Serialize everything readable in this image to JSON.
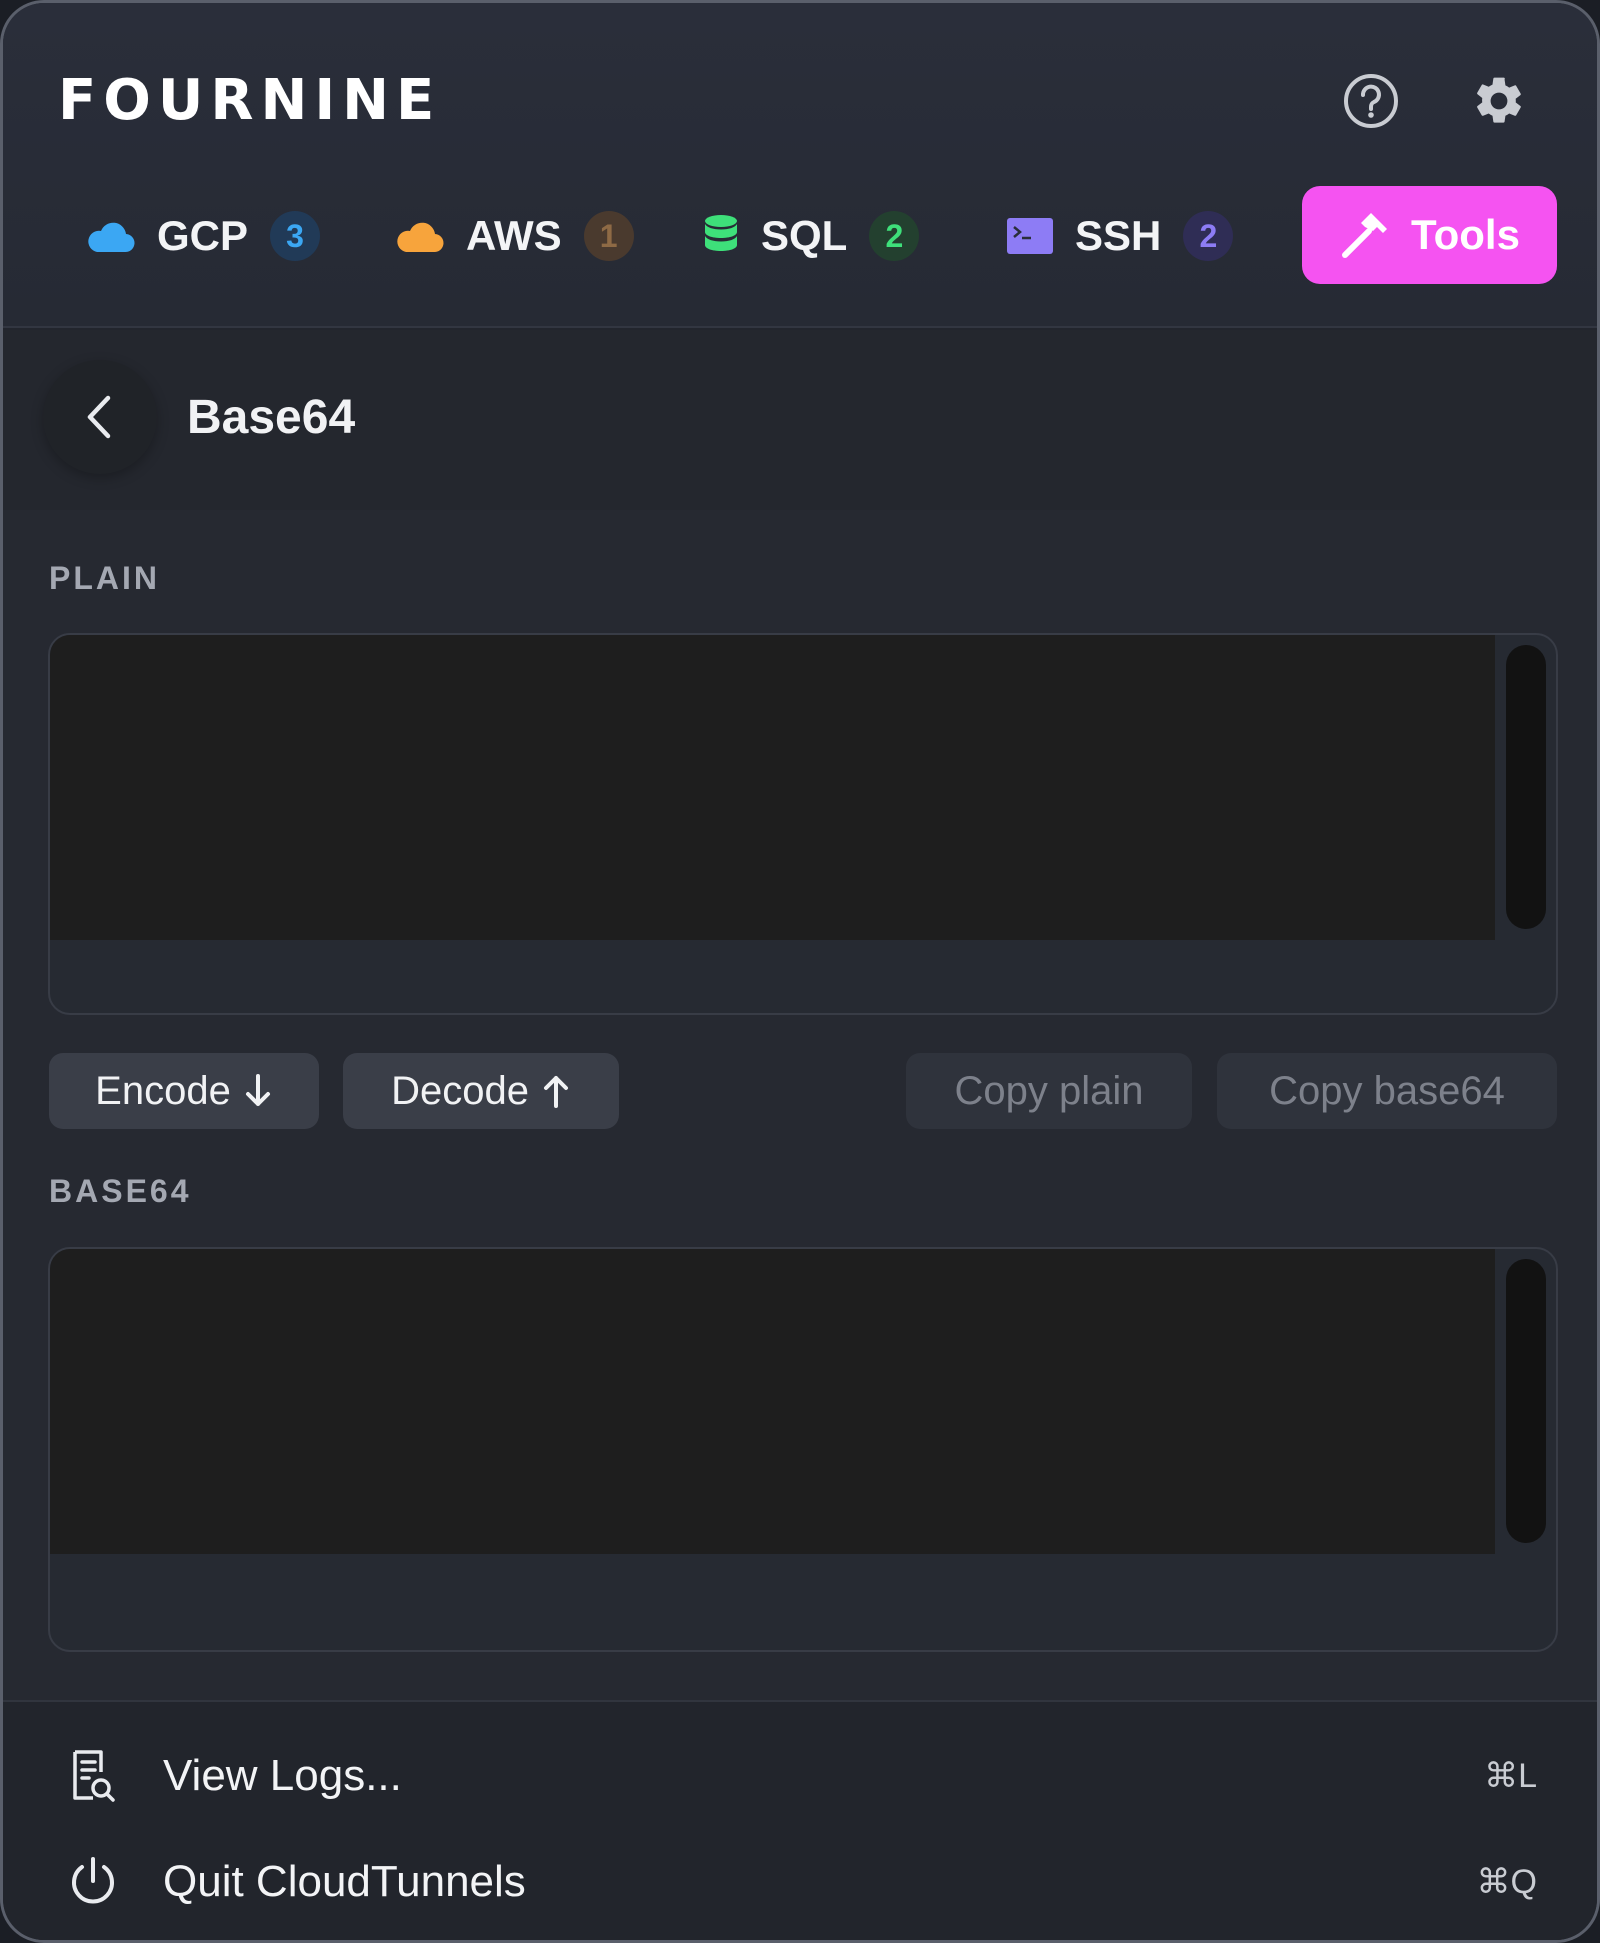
{
  "app": {
    "brand": "FOURNINE"
  },
  "header": {
    "help_icon": "help-circle-icon",
    "settings_icon": "gear-icon"
  },
  "tabs": [
    {
      "label": "GCP",
      "badge": "3",
      "icon": "cloud-icon",
      "icon_color": "#3ba7f3",
      "badge_bg": "#213a57",
      "badge_color": "#3ba7f3"
    },
    {
      "label": "AWS",
      "badge": "1",
      "icon": "cloud-icon",
      "icon_color": "#f7a43c",
      "badge_bg": "#4a3a2e",
      "badge_color": "#8e6a45"
    },
    {
      "label": "SQL",
      "badge": "2",
      "icon": "database-icon",
      "icon_color": "#3ee07a",
      "badge_bg": "#23402f",
      "badge_color": "#3ee07a"
    },
    {
      "label": "SSH",
      "badge": "2",
      "icon": "terminal-icon",
      "icon_color": "#8d7cf5",
      "badge_bg": "#2f2d55",
      "badge_color": "#8d7cf5"
    },
    {
      "label": "Tools",
      "icon": "hammer-icon",
      "active": true,
      "accent": "#f553f1"
    }
  ],
  "page": {
    "title": "Base64",
    "back_icon": "chevron-left-icon"
  },
  "plain": {
    "label": "PLAIN",
    "value": ""
  },
  "base64": {
    "label": "BASE64",
    "value": ""
  },
  "actions": {
    "encode": "Encode",
    "decode": "Decode",
    "copy_plain": "Copy plain",
    "copy_base64": "Copy base64"
  },
  "footer": {
    "view_logs": "View Logs...",
    "view_logs_shortcut": "⌘L",
    "quit": "Quit CloudTunnels",
    "quit_shortcut": "⌘Q"
  }
}
